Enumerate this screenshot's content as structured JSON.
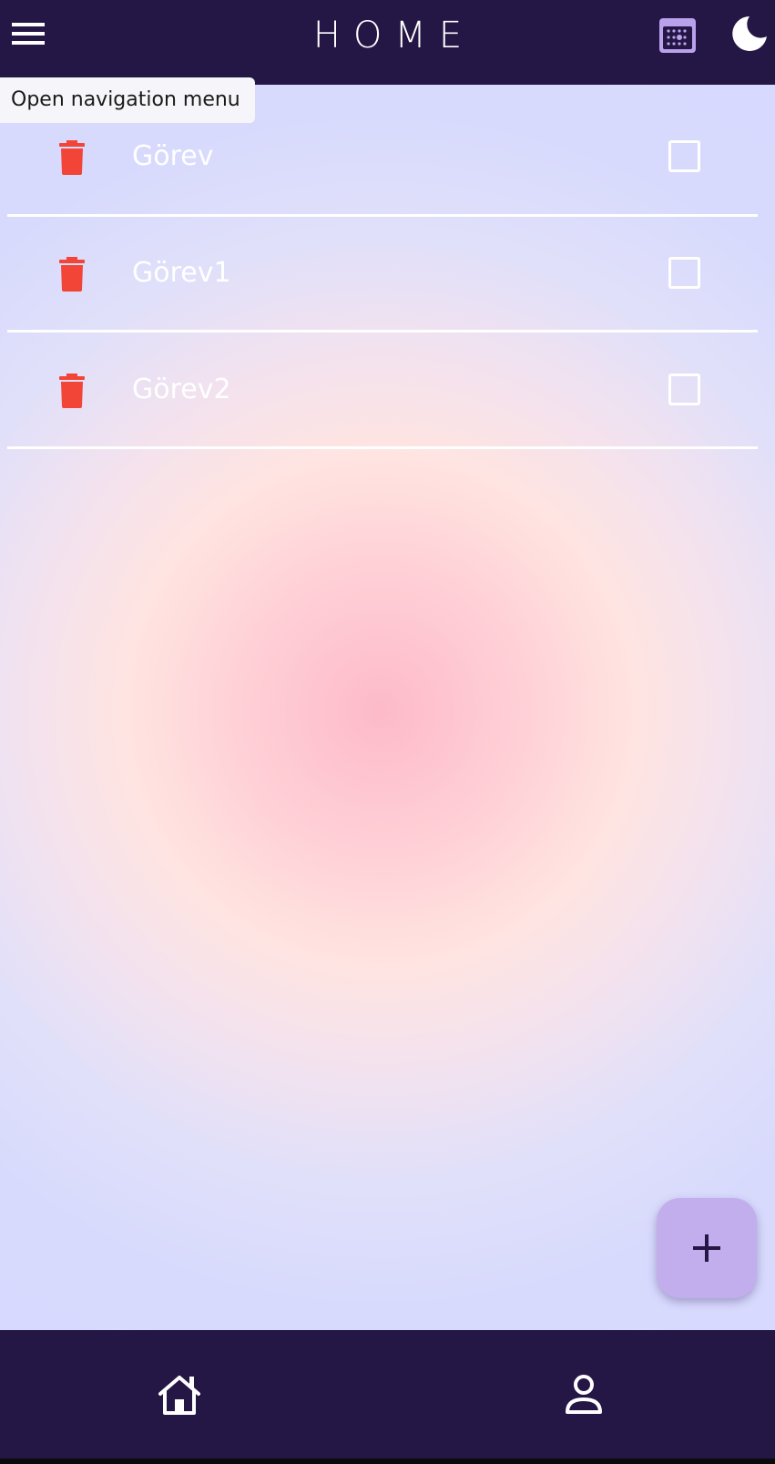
{
  "app_bar": {
    "title": "HOME",
    "background": "#241645",
    "icons": {
      "menu": "menu-icon",
      "calendar": "calendar-icon",
      "theme": "moon-icon"
    }
  },
  "tooltip": {
    "text": "Open navigation menu"
  },
  "tasks": [
    {
      "label": "Görev",
      "checked": false
    },
    {
      "label": "Görev1",
      "checked": false
    },
    {
      "label": "Görev2",
      "checked": false
    }
  ],
  "colors": {
    "delete_icon": "#f24437",
    "fab": "#c2aeec",
    "nav_bar": "#241645",
    "calendar_icon": "#b9a1ec"
  },
  "fab": {
    "icon": "plus-icon"
  },
  "bottom_nav": {
    "items": [
      {
        "icon": "home-icon"
      },
      {
        "icon": "person-icon"
      }
    ]
  }
}
